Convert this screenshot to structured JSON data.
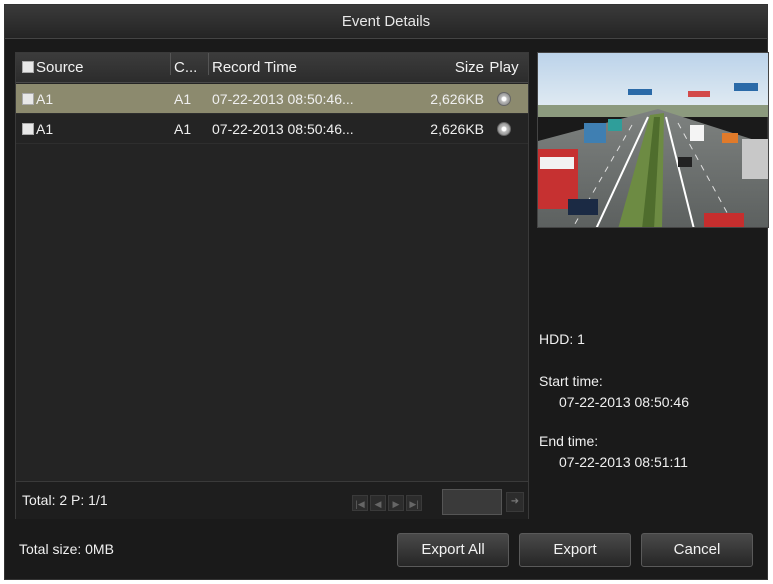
{
  "window": {
    "title": "Event Details"
  },
  "table": {
    "headers": {
      "source": "Source",
      "c": "C...",
      "time": "Record Time",
      "size": "Size",
      "play": "Play"
    },
    "rows": [
      {
        "source": "A1",
        "c": "A1",
        "time": "07-22-2013 08:50:46...",
        "size": "2,626KB",
        "selected": true
      },
      {
        "source": "A1",
        "c": "A1",
        "time": "07-22-2013 08:50:46...",
        "size": "2,626KB",
        "selected": false
      }
    ],
    "footer": {
      "total": "Total: 2  P: 1/1"
    }
  },
  "details": {
    "hdd": "HDD: 1",
    "start_label": "Start time:",
    "start_value": "07-22-2013 08:50:46",
    "end_label": "End time:",
    "end_value": "07-22-2013 08:51:11"
  },
  "bottom": {
    "total_size": "Total size: 0MB",
    "export_all": "Export All",
    "export": "Export",
    "cancel": "Cancel"
  },
  "icons": {
    "play": "play-circle-icon",
    "pager": [
      "first-page-icon",
      "prev-page-icon",
      "next-page-icon",
      "last-page-icon"
    ],
    "go": "go-icon"
  }
}
